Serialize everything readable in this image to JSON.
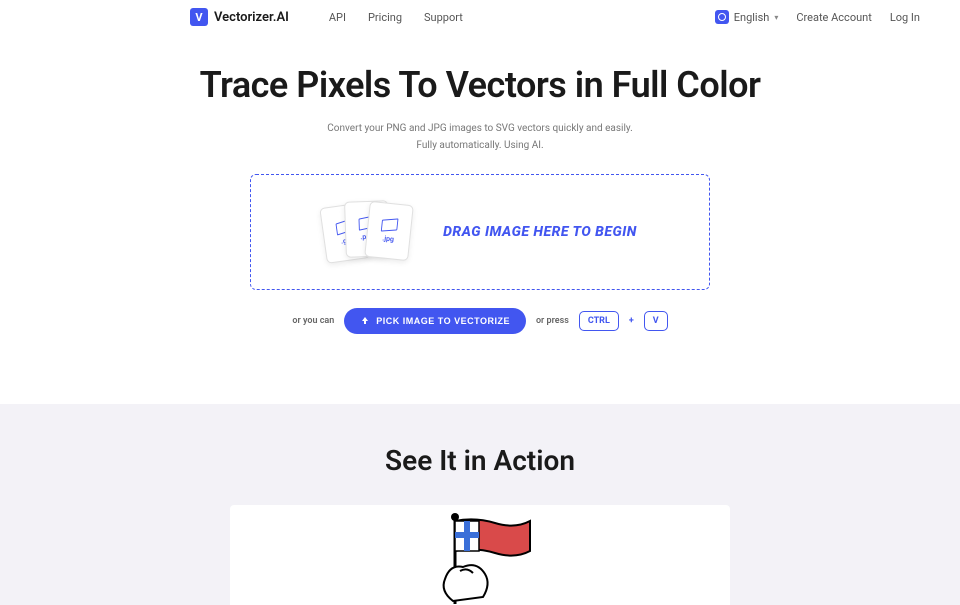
{
  "header": {
    "brand": "Vectorizer.AI",
    "logo_letter": "V",
    "nav": [
      "API",
      "Pricing",
      "Support"
    ],
    "language": "English",
    "create_account": "Create Account",
    "log_in": "Log In"
  },
  "hero": {
    "title": "Trace Pixels To Vectors in Full Color",
    "sub_line1": "Convert your PNG and JPG images to SVG vectors quickly and easily.",
    "sub_line2": "Fully automatically. Using AI.",
    "drop_label": "DRAG IMAGE HERE TO BEGIN",
    "file_exts": [
      ".gif",
      ".png",
      ".jpg"
    ],
    "or_text": "or you can",
    "pick_button": "PICK IMAGE TO VECTORIZE",
    "or_press": "or press",
    "key1": "CTRL",
    "plus": "+",
    "key2": "V"
  },
  "section2": {
    "title": "See It in Action"
  }
}
